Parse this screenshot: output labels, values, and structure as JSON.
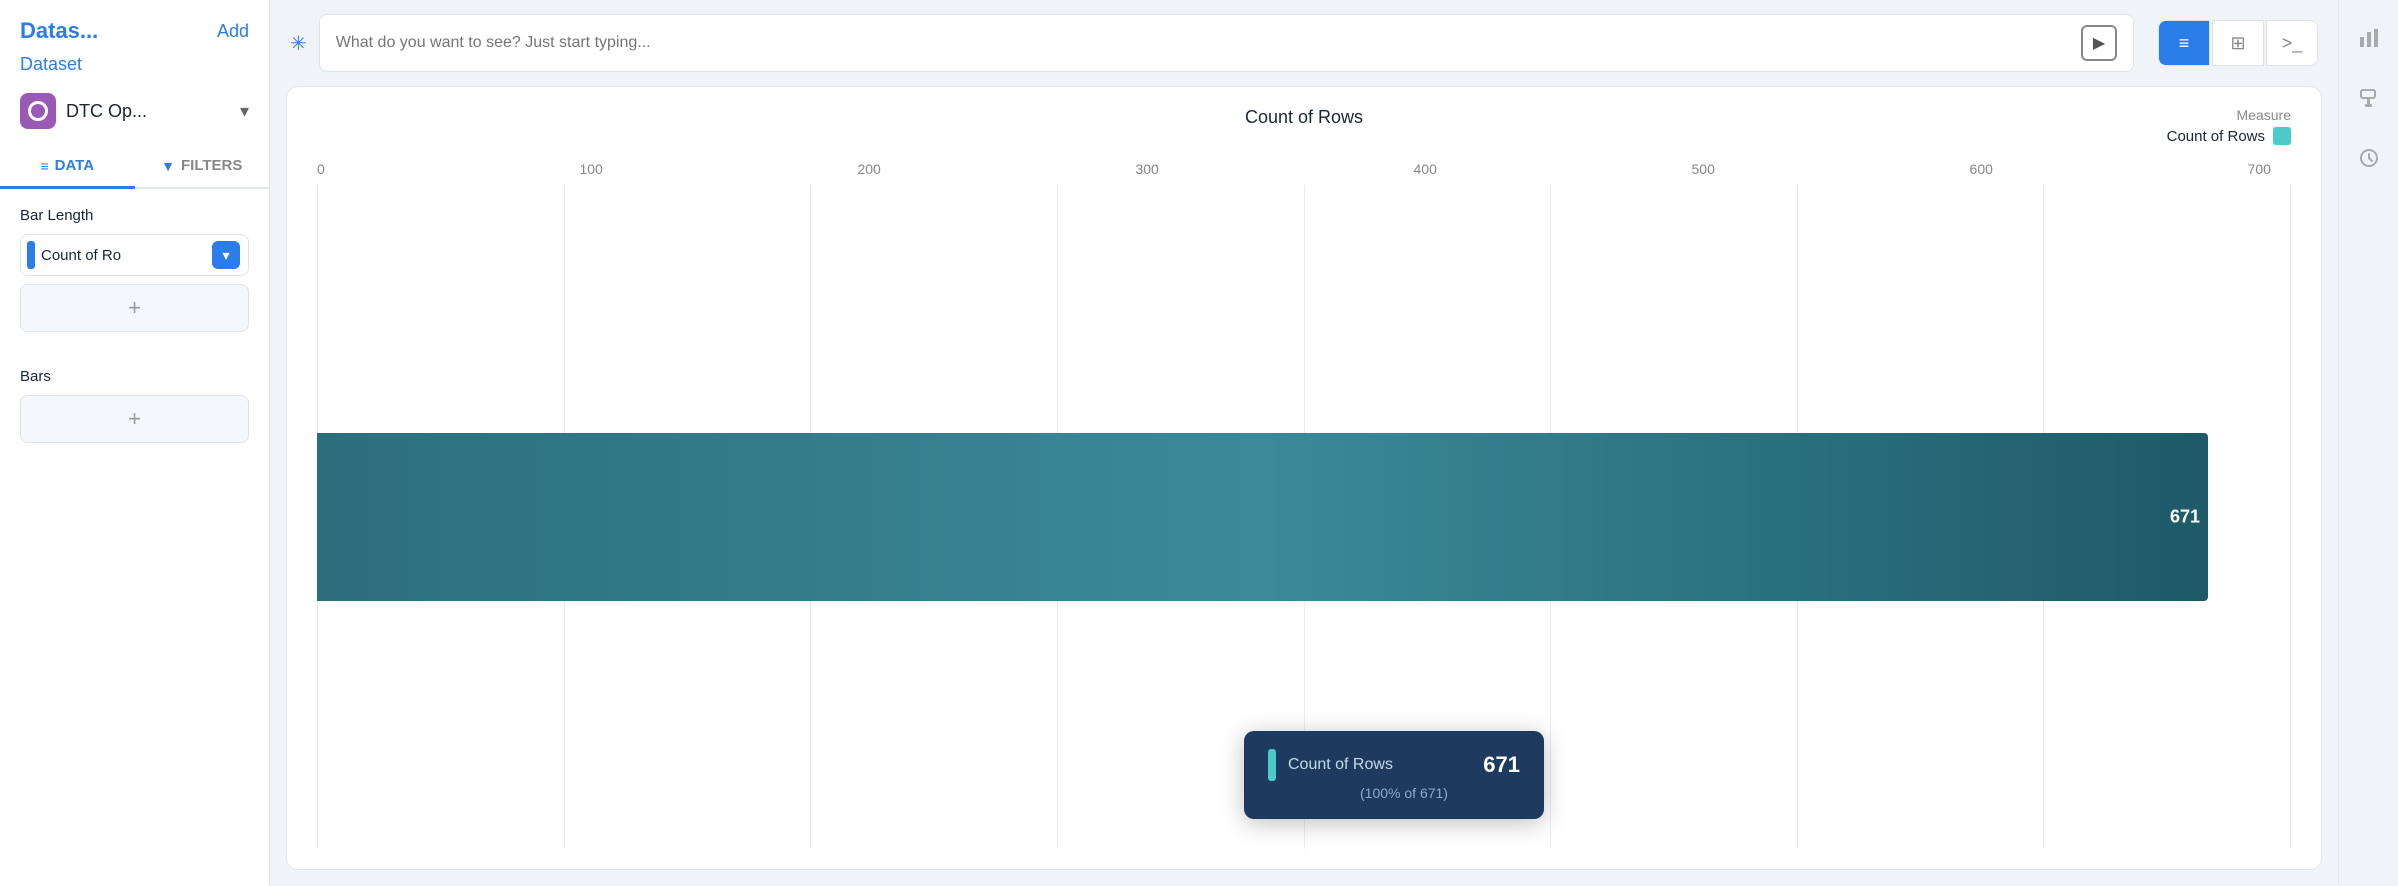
{
  "sidebar": {
    "add_label": "Add",
    "datas_label": "Datas...",
    "dataset_label": "Dataset",
    "dataset_name": "DTC Op...",
    "nav": {
      "data_label": "DATA",
      "filters_label": "FILTERS"
    },
    "bar_length_label": "Bar Length",
    "field_pill_text": "Count of Ro",
    "field_pill_btn": "▾",
    "bars_label": "Bars",
    "add_btn_label": "+"
  },
  "topbar": {
    "search_placeholder": "What do you want to see? Just start typing...",
    "view_buttons": [
      "≡",
      "⊞",
      ">_"
    ]
  },
  "chart": {
    "title": "Count of Rows",
    "x_labels": [
      "0",
      "100",
      "200",
      "300",
      "400",
      "500",
      "600",
      "700"
    ],
    "bar_value": "671",
    "bar_width_percent": 95.8,
    "legend": {
      "label": "Measure",
      "item_name": "Count of Rows"
    },
    "tooltip": {
      "label": "Count of Rows",
      "value": "671",
      "percent_text": "(100% of 671)"
    }
  },
  "right_icons": [
    "bar-chart-icon",
    "paint-roller-icon",
    "clock-icon"
  ]
}
